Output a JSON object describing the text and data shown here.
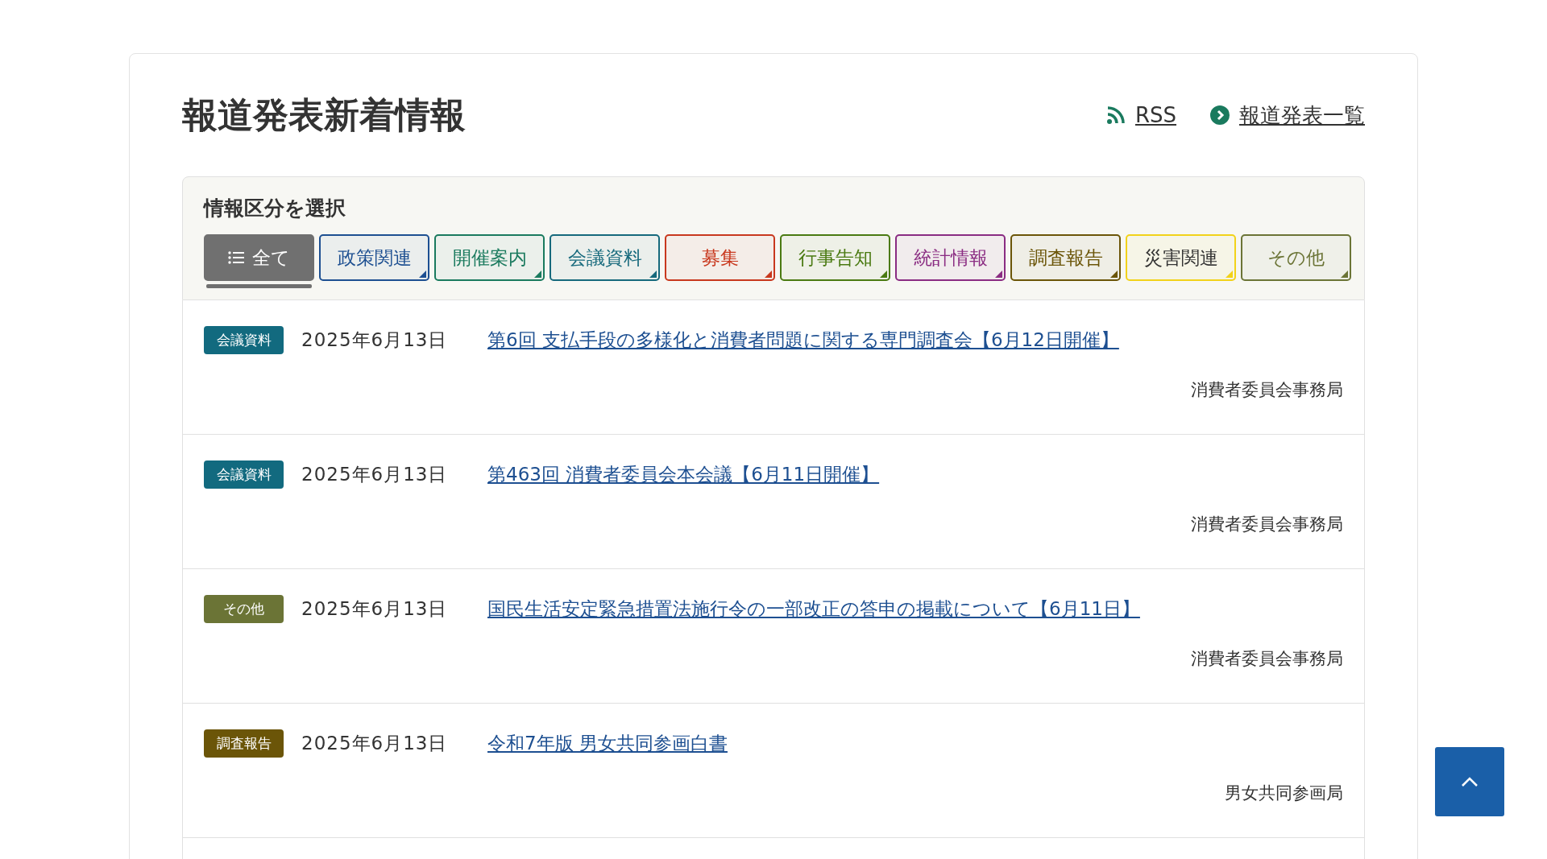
{
  "title": "報道発表新着情報",
  "links": [
    {
      "kind": "rss",
      "label": "RSS"
    },
    {
      "kind": "list",
      "label": "報道発表一覧"
    }
  ],
  "filter": {
    "heading": "情報区分を選択",
    "buttons": [
      {
        "label": "全て",
        "selected": true,
        "color": "#707070"
      },
      {
        "label": "政策関連",
        "selected": false,
        "color": "#1d4f91"
      },
      {
        "label": "開催案内",
        "selected": false,
        "color": "#1a7a5e"
      },
      {
        "label": "会議資料",
        "selected": false,
        "color": "#16697c"
      },
      {
        "label": "募集",
        "selected": false,
        "color": "#c8381e"
      },
      {
        "label": "行事告知",
        "selected": false,
        "color": "#4a7a12"
      },
      {
        "label": "統計情報",
        "selected": false,
        "color": "#8a2c82"
      },
      {
        "label": "調査報告",
        "selected": false,
        "color": "#6b5508"
      },
      {
        "label": "災害関連",
        "selected": false,
        "color": "#f2d21a"
      },
      {
        "label": "その他",
        "selected": false,
        "color": "#6b7436"
      }
    ]
  },
  "items": [
    {
      "tag": "会議資料",
      "color": "#126a7f",
      "date": "2025年6月13日",
      "title": "第6回 支払手段の多様化と消費者問題に関する専門調査会【6月12日開催】",
      "source": "消費者委員会事務局"
    },
    {
      "tag": "会議資料",
      "color": "#126a7f",
      "date": "2025年6月13日",
      "title": "第463回 消費者委員会本会議【6月11日開催】",
      "source": "消費者委員会事務局"
    },
    {
      "tag": "その他",
      "color": "#6b7436",
      "date": "2025年6月13日",
      "title": "国民生活安定緊急措置法施行令の一部改正の答申の掲載について【6月11日】",
      "source": "消費者委員会事務局"
    },
    {
      "tag": "調査報告",
      "color": "#6b5508",
      "date": "2025年6月13日",
      "title": "令和7年版 男女共同参画白書",
      "source": "男女共同参画局"
    }
  ]
}
